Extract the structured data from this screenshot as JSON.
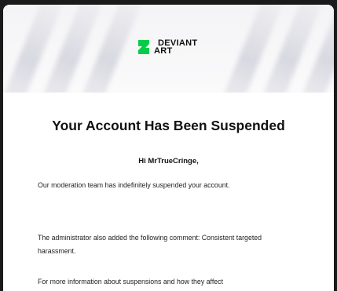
{
  "brand": {
    "name_line1": "DEVIANT",
    "name_line2": "ART",
    "logo_icon": "deviantart-logo-icon",
    "accent_color": "#05cc47"
  },
  "email": {
    "title": "Your Account Has Been Suspended",
    "greeting": "Hi MrTrueCringe,",
    "paragraphs": [
      "Our moderation team has indefinitely suspended your account.",
      "The administrator also added the following comment: Consistent targeted harassment.",
      "For more information about suspensions and how they affect"
    ]
  }
}
